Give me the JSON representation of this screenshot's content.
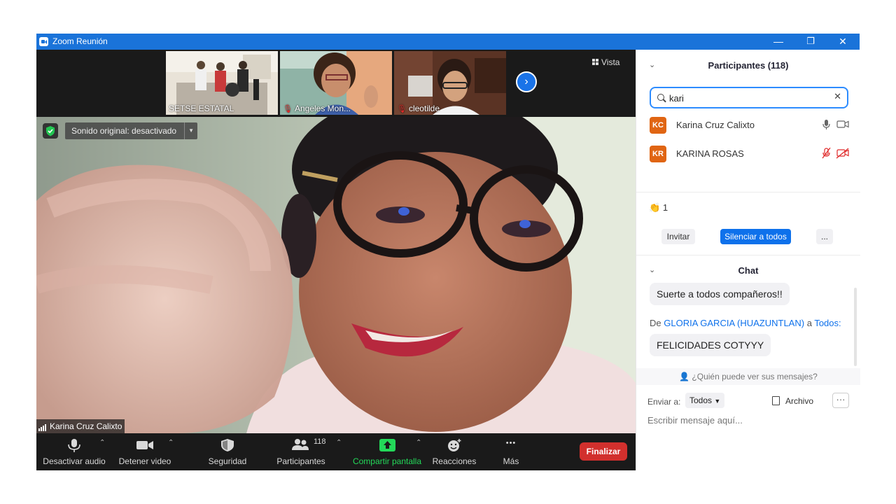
{
  "window": {
    "title": "Zoom Reunión",
    "minimize_glyph": "—",
    "restore_glyph": "❐",
    "close_glyph": "✕"
  },
  "gallery": {
    "thumbnails": [
      {
        "name": "SETSE ESTATAL",
        "muted": false
      },
      {
        "name": "Angeles Mon...",
        "muted": true
      },
      {
        "name": "cleotilde",
        "muted": true
      }
    ],
    "next_glyph": "›",
    "view_label": "Vista"
  },
  "main_video": {
    "original_sound_label": "Sonido original: desactivado",
    "speaker_name": "Karina Cruz Calixto"
  },
  "toolbar": {
    "mute_label": "Desactivar audio",
    "video_label": "Detener video",
    "security_label": "Seguridad",
    "participants_label": "Participantes",
    "participants_count": "118",
    "share_label": "Compartir pantalla",
    "reactions_label": "Reacciones",
    "more_label": "Más",
    "end_label": "Finalizar",
    "more_glyph": "•••"
  },
  "participants_panel": {
    "title": "Participantes (118)",
    "search_value": "kari",
    "results": [
      {
        "initials": "KC",
        "name": "Karina Cruz Calixto",
        "audio": "on",
        "video": "off-plain"
      },
      {
        "initials": "KR",
        "name": "KARINA ROSAS",
        "audio": "muted",
        "video": "muted"
      }
    ],
    "raised_reactions": "1",
    "invite_label": "Invitar",
    "mute_all_label": "Silenciar a todos",
    "more_label": "..."
  },
  "chat": {
    "title": "Chat",
    "message_1": "Suerte a todos compañeros!!",
    "from_prefix": "De",
    "from_sender": "GLORIA GARCIA (HUAZUNTLAN)",
    "from_to": "a",
    "from_recipient": "Todos:",
    "message_2": "FELICIDADES COTYYY",
    "who_can_see": "¿Quién puede ver sus mensajes?",
    "send_to_label": "Enviar a:",
    "send_to_value": "Todos",
    "file_label": "Archivo",
    "more_glyph": "···",
    "input_placeholder": "Escribir mensaje aquí..."
  },
  "colors": {
    "titlebar": "#1a73d9",
    "accent_blue": "#0e71eb",
    "end_red": "#d2302d",
    "share_green": "#23d959",
    "avatar_orange": "#e06513"
  }
}
